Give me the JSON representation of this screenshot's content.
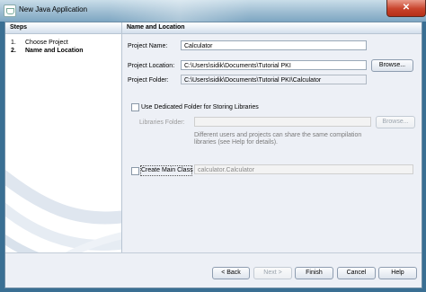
{
  "window": {
    "title": "New Java Application",
    "close_glyph": "✕"
  },
  "steps": {
    "header": "Steps",
    "items": [
      {
        "num": "1.",
        "label": "Choose Project"
      },
      {
        "num": "2.",
        "label": "Name and Location"
      }
    ]
  },
  "panel": {
    "header": "Name and Location",
    "project_name_label": "Project Name:",
    "project_name_value": "Calculator",
    "project_location_label": "Project Location:",
    "project_location_value": "C:\\Users\\sidik\\Documents\\Tutorial PKI",
    "browse_label": "Browse...",
    "project_folder_label": "Project Folder:",
    "project_folder_value": "C:\\Users\\sidik\\Documents\\Tutorial PKI\\Calculator",
    "dedicated_folder_label": "Use Dedicated Folder for Storing Libraries",
    "libraries_folder_label": "Libraries Folder:",
    "libraries_browse_label": "Browse...",
    "libraries_note_line1": "Different users and projects can share the same compilation",
    "libraries_note_line2": "libraries (see Help for details).",
    "create_main_label": "Create Main Class",
    "main_class_value": "calculator.Calculator"
  },
  "buttons": {
    "back": "< Back",
    "next": "Next >",
    "finish": "Finish",
    "cancel": "Cancel",
    "help": "Help"
  },
  "colors": {
    "steps_header": "#d3dfec",
    "panel_bg": "#edf0f6",
    "titlebar": "#9ebdd2",
    "close": "#c8432b"
  }
}
